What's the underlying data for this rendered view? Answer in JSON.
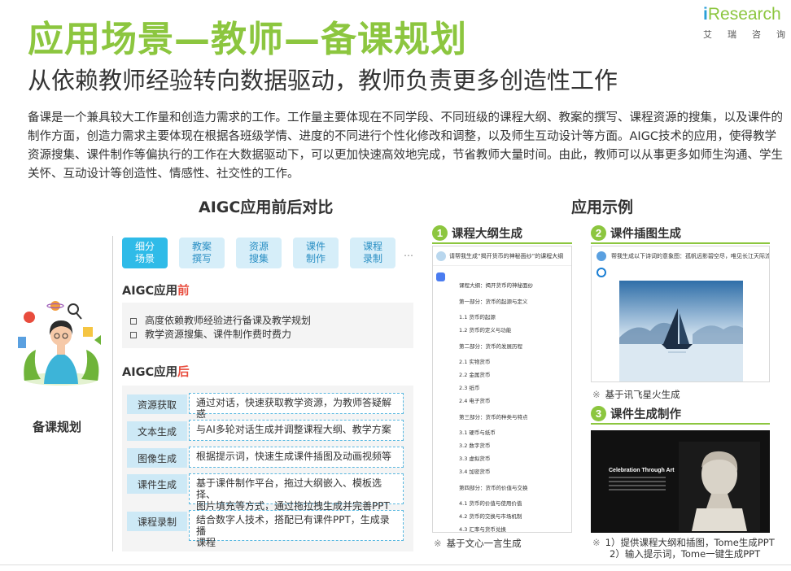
{
  "header": {
    "title": "应用场景—教师—备课规划",
    "subtitle": "从依赖教师经验转向数据驱动，教师负责更多创造性工作",
    "logo_i": "i",
    "logo_word": "Research",
    "logo_sub": "艾瑞咨询"
  },
  "intro": "备课是一个兼具较大工作量和创造力需求的工作。工作量主要体现在不同学段、不同班级的课程大纲、教案的撰写、课程资源的搜集，以及课件的制作方面，创造力需求主要体现在根据各班级学情、进度的不同进行个性化修改和调整，以及师生互动设计等方面。AIGC技术的应用，使得教学资源搜集、课件制作等偏执行的工作在大数据驱动下，可以更加快速高效地完成，节省教师大量时间。由此，教师可以从事更多如师生沟通、学生关怀、互动设计等创造性、情感性、社交性的工作。",
  "left": {
    "heading": "AIGC应用前后对比",
    "illustration_label": "备课规划",
    "tabs": [
      "细分\n场景",
      "教案\n撰写",
      "资源\n搜集",
      "课件\n制作",
      "课程\n录制"
    ],
    "tabs_more": "…",
    "before": {
      "label_main": "AIGC应用",
      "label_hl": "前",
      "items": [
        "高度依赖教师经验进行备课及教学规划",
        "教学资源搜集、课件制作费时费力"
      ]
    },
    "after": {
      "label_main": "AIGC应用",
      "label_hl": "后",
      "rows": [
        {
          "tag": "资源获取",
          "desc": "通过对话，快速获取教学资源，为教师答疑解惑"
        },
        {
          "tag": "文本生成",
          "desc": "与AI多轮对话生成并调整课程大纲、教学方案"
        },
        {
          "tag": "图像生成",
          "desc": "根据提示词，快速生成课件插图及动画视频等"
        },
        {
          "tag": "课件生成",
          "desc": "基于课件制作平台，拖过大纲嵌入、模板选择、\n图片填充等方式，通过拖拉拽生成并完善PPT"
        },
        {
          "tag": "课程录制",
          "desc": "结合数字人技术，搭配已有课件PPT，生成录播\n课程"
        }
      ]
    }
  },
  "right": {
    "heading": "应用示例",
    "ex1": {
      "num": "1",
      "title": "课程大纲生成",
      "query": "请帮我生成“揭开货币的神秘面纱”的课程大纲",
      "lines": [
        "课程大纲：揭开货币的神秘面纱",
        "第一部分：货币的起源与定义",
        "1.1 货币的起源",
        "1.2 货币的定义与功能",
        "第二部分：货币的发展历程",
        "2.1 实物货币",
        "2.2 金属货币",
        "2.3 纸币",
        "2.4 电子货币",
        "第三部分：货币的种类与特点",
        "3.1 硬币与纸币",
        "3.2 数字货币",
        "3.3 虚拟货币",
        "3.4 加密货币",
        "第四部分：货币的价值与交换",
        "4.1 货币的价值与使用价值",
        "4.2 货币的交换与市场机制",
        "4.3 汇率与货币兑换"
      ],
      "note": "基于文心一言生成"
    },
    "ex2": {
      "num": "2",
      "title": "课件插图生成",
      "query": "帮我生成以下诗词的意象图：孤帆远影碧空尽，唯见长江天际流",
      "note": "基于讯飞星火生成"
    },
    "ex3": {
      "num": "3",
      "title": "课件生成制作",
      "slide_title": "Celebration Through Art",
      "note_1": "1）提供课程大纲和插图，Tome生成PPT",
      "note_2": "2）输入提示词，Tome一键生成PPT"
    },
    "note_mark": "※"
  },
  "colors": {
    "brand_green": "#8cc63f",
    "accent_blue": "#2fbbe8",
    "highlight_red": "#e84c3d"
  }
}
